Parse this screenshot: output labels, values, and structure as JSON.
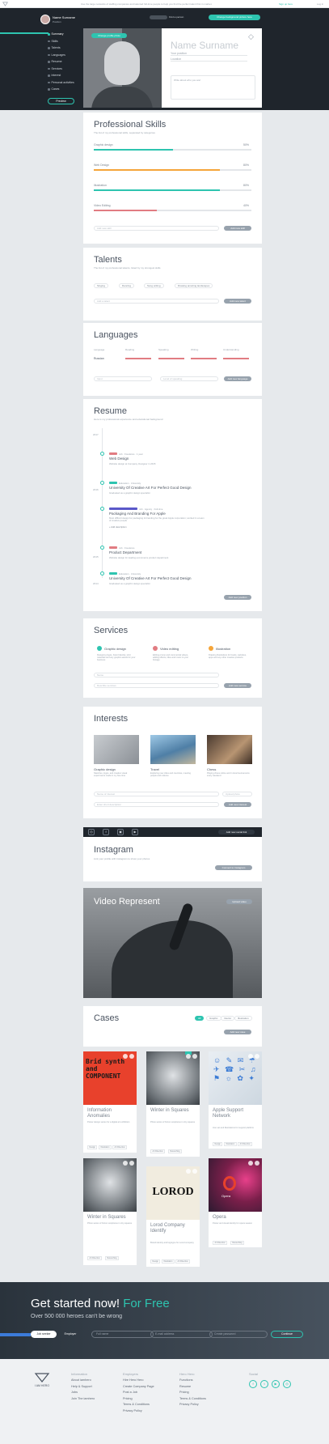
{
  "topbar": {
    "message": "Use the large networks of staffing companies and talented full-time people to help you find the perfect talent first in market.",
    "sign_up": "Sign up here",
    "login": "Log in"
  },
  "header": {
    "user_name": "Name Surname",
    "user_position": "Position",
    "switch_label": "Find a person",
    "cta": "Change background picture here"
  },
  "nav": {
    "items": [
      "Summary",
      "Skills",
      "Talents",
      "Languages",
      "Resume",
      "Services",
      "Interest",
      "Personal activities",
      "Cases"
    ],
    "preview": "Preview"
  },
  "profile": {
    "change_photo": "Change profile photo",
    "name": "Name Surname",
    "position": "Your position",
    "location": "Location",
    "about_placeholder": "Write about who you are!"
  },
  "skills": {
    "title": "Professional Skills",
    "subtitle": "The list of my professional skills, separated by categories",
    "items": [
      {
        "label": "Graphic design",
        "pct": "50%",
        "value": 0.5,
        "color": "#2ec4b0"
      },
      {
        "label": "Web Design",
        "pct": "80%",
        "value": 0.8,
        "color": "#f5a53a"
      },
      {
        "label": "Illustration",
        "pct": "80%",
        "value": 0.8,
        "color": "#2ec4b0"
      },
      {
        "label": "Video Editing",
        "pct": "40%",
        "value": 0.4,
        "color": "#e17c82"
      }
    ],
    "input_placeholder": "Add new skill",
    "add_button": "Add new skill"
  },
  "talents": {
    "title": "Talents",
    "subtitle": "The list of my professional talents, listed by my strongest skills",
    "tags": [
      "Singing",
      "Dancing",
      "Song writing",
      "Drawing amazing landscapes"
    ],
    "input_placeholder": "Add a talent",
    "add_button": "Add new talent"
  },
  "languages": {
    "title": "Languages",
    "columns": [
      "Language",
      "Reading",
      "Speaking",
      "Writing",
      "Understanding"
    ],
    "row_language": "Russian",
    "input_language": "Input",
    "input_level": "Level of speaking",
    "add_button": "Add new language"
  },
  "resume": {
    "title": "Resume",
    "subtitle": "Here is my professional experience and educational background",
    "entries": [
      {
        "year": "2017",
        "badge_color": "#e17c82",
        "meta": "Job  ·  Freelance  ·  1 year",
        "title": "Web Design",
        "detail": "Website design at Company, Designer in 2015"
      },
      {
        "year": "2016",
        "badge_color": "#2ec4b0",
        "meta": "Education  ·  University",
        "title": "University Of Creative Art For Perfect Good Design",
        "detail": "Graduated as a graphic design specialist"
      },
      {
        "year": "",
        "badge_color": "#5a58c9",
        "meta": "Job  ·  Agency  ·  Full-time",
        "title": "Packaging And Branding For Apple",
        "detail": "Most difficult design for packaging & branding for the great Apple corporation; worked in a team of creative people",
        "detail2": "+ Add description"
      },
      {
        "year": "2015",
        "badge_color": "#e17c82",
        "meta": "Job  ·  Freelance",
        "title": "Product Department",
        "detail": "Website design for leading ecommerce product department"
      },
      {
        "year": "2014",
        "badge_color": "#2ec4b0",
        "meta": "Education  ·  University",
        "title": "University Of Creative Art For Perfect Good Design",
        "detail": "Graduated as a graphic design specialist"
      }
    ],
    "add_button": "Add new position"
  },
  "services": {
    "title": "Services",
    "items": [
      {
        "title": "Graphic design",
        "text": "Designing logos, brand identity, print materials and any graphic assets for your business",
        "color": "#2ec4b0"
      },
      {
        "title": "Video editing",
        "text": "Editing promo and commercial videos, adding effects, titles and music to your footage",
        "color": "#e17c82"
      },
      {
        "title": "Illustration",
        "text": "Drawing illustrations for books, websites, apps and any other creative products",
        "color": "#f5a53a"
      }
    ],
    "input_name": "Name",
    "input_desc": "Describe services",
    "add_button": "Add new service"
  },
  "interests": {
    "title": "Interests",
    "items": [
      {
        "title": "Graphic design",
        "text": "Sketches, logos, and creative visual experiments made in my free time"
      },
      {
        "title": "Travel",
        "text": "Exploring new cities and countries, meeting people and cultures"
      },
      {
        "title": "Chess",
        "text": "Playing chess online and in local tournaments every weekend"
      }
    ],
    "input_name": "Name of interest",
    "input_desc": "Enter short description",
    "upload_photo": "Upload photo",
    "add_button": "Add new interest"
  },
  "instagram": {
    "title": "Instagram",
    "subtitle": "Link your profile with Instagram to show your photos",
    "add_button": "Add new social link",
    "connect": "Connect to Instagram"
  },
  "video": {
    "title": "Video Represent",
    "upload": "Upload video"
  },
  "cases": {
    "title": "Cases",
    "filters": [
      "All",
      "Graphic",
      "Interior",
      "Illustration"
    ],
    "add_button": "Add new case",
    "items": [
      {
        "title": "Information Anomalies",
        "text": "Poster design series for a digital art exhibition",
        "tags": [
          "Design",
          "Illustration",
          "Art Direction"
        ]
      },
      {
        "title": "Winter in Squares",
        "text": "Photo series of frozen sculptures in city squares",
        "tags": [
          "Art Direction",
          "Retouching"
        ]
      },
      {
        "title": "Apple Support Network",
        "text": "Icon set and illustrations for support platform",
        "tags": [
          "Design",
          "Illustration",
          "Art Direction"
        ]
      },
      {
        "title": "Winter in Squares",
        "text": "Photo series of frozen sculptures in city squares",
        "tags": [
          "Art Direction",
          "Retouching"
        ]
      },
      {
        "title": "Lorod Company Identify",
        "text": "Brand identity and logotype for Lorod company",
        "tags": [
          "Design",
          "Illustration",
          "Art Direction"
        ]
      },
      {
        "title": "Opera",
        "text": "Poster and visual identity for opera season",
        "tags": [
          "Art Direction",
          "Retouching"
        ]
      }
    ],
    "logo_text": "LOROD",
    "poster_text": "Brid synth and COMPONENT"
  },
  "signup": {
    "title": "Get started now!",
    "title_accent": "For Free",
    "subtitle": "Over 500 000 heroes can't be wrong",
    "role_job": "Job seeker",
    "role_employer": "Employer",
    "full_name": "Full name",
    "email": "E-mail address",
    "password": "Create password",
    "continue": "Continue"
  },
  "footer": {
    "logo": "I AM HERO",
    "columns": [
      {
        "heading": "Information",
        "links": [
          "About iamhero",
          "Help & Support",
          "Jobs",
          "Join The iamhero"
        ]
      },
      {
        "heading": "Employers",
        "links": [
          "Hire Hero Hero",
          "Create Company Page",
          "Post a Job",
          "Pricing",
          "Terms & Conditions",
          "Privacy Policy"
        ]
      },
      {
        "heading": "Hero Hero",
        "links": [
          "Functions",
          "Resume",
          "Pricing",
          "Terms & Conditions",
          "Privacy Policy"
        ]
      }
    ],
    "social_heading": "Social"
  }
}
